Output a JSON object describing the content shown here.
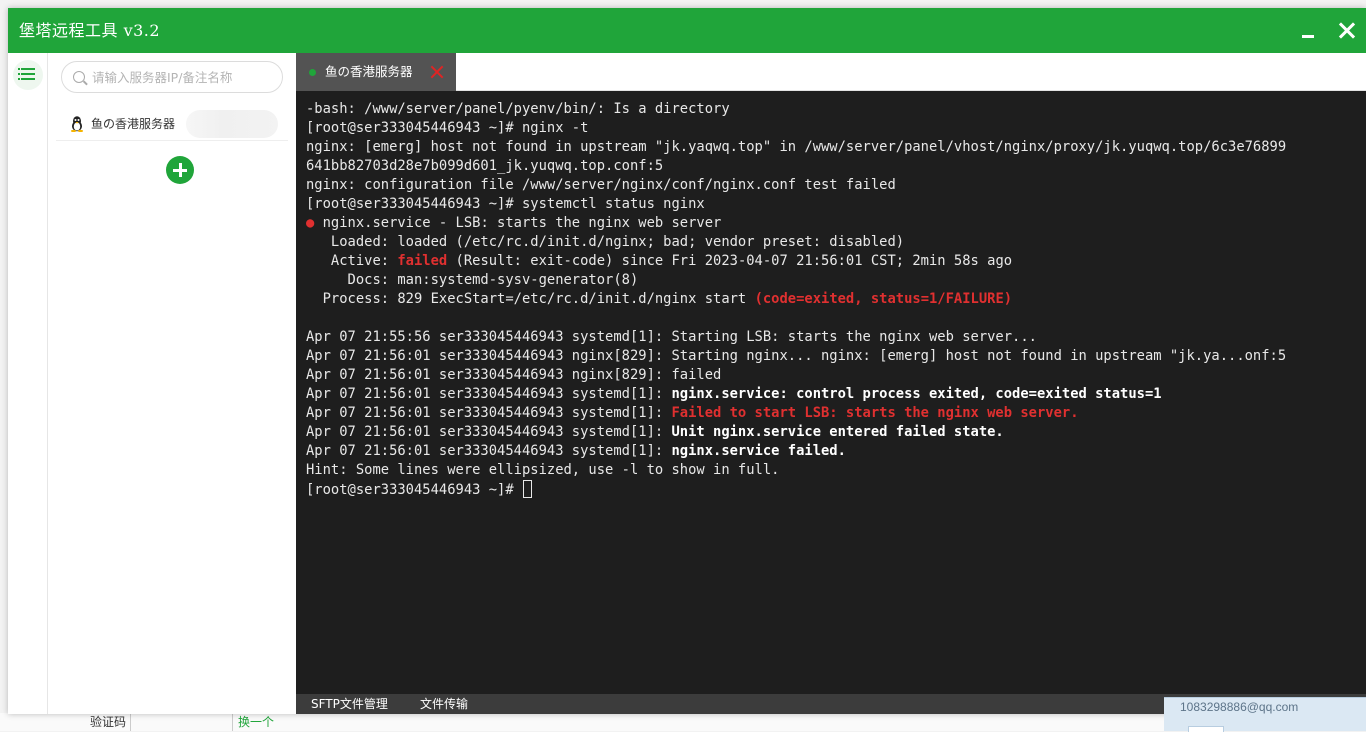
{
  "window": {
    "title": "堡塔远程工具 v3.2",
    "accent_color": "#20a53a"
  },
  "sidebar": {
    "search_placeholder": "请输入服务器IP/备注名称",
    "servers": [
      {
        "label": "鱼の香港服务器",
        "os_icon": "linux-tux-icon"
      }
    ]
  },
  "tabs": [
    {
      "label": "鱼の香港服务器",
      "status": "connected"
    }
  ],
  "terminal": {
    "lines": [
      [
        {
          "t": "-bash: /www/server/panel/pyenv/bin/: Is a directory"
        }
      ],
      [
        {
          "t": "[root@ser333045446943 ~]# nginx -t"
        }
      ],
      [
        {
          "t": "nginx: [emerg] host not found in upstream \"jk.yaqwq.top\" in /www/server/panel/vhost/nginx/proxy/jk.yuqwq.top/6c3e76899"
        }
      ],
      [
        {
          "t": "641bb82703d28e7b099d601_jk.yuqwq.top.conf:5"
        }
      ],
      [
        {
          "t": "nginx: configuration file /www/server/nginx/conf/nginx.conf test failed"
        }
      ],
      [
        {
          "t": "[root@ser333045446943 ~]# systemctl status nginx"
        }
      ],
      [
        {
          "t": "●",
          "s": "r"
        },
        {
          "t": " nginx.service - LSB: starts the nginx web server"
        }
      ],
      [
        {
          "t": "   Loaded: loaded (/etc/rc.d/init.d/nginx; bad; vendor preset: disabled)"
        }
      ],
      [
        {
          "t": "   Active: "
        },
        {
          "t": "failed",
          "s": "rb"
        },
        {
          "t": " (Result: exit-code) since Fri 2023-04-07 21:56:01 CST; 2min 58s ago"
        }
      ],
      [
        {
          "t": "     Docs: man:systemd-sysv-generator(8)"
        }
      ],
      [
        {
          "t": "  Process: 829 ExecStart=/etc/rc.d/init.d/nginx start "
        },
        {
          "t": "(code=exited, status=1/FAILURE)",
          "s": "rb"
        }
      ],
      [
        {
          "t": ""
        }
      ],
      [
        {
          "t": "Apr 07 21:55:56 ser333045446943 systemd[1]: Starting LSB: starts the nginx web server..."
        }
      ],
      [
        {
          "t": "Apr 07 21:56:01 ser333045446943 nginx[829]: Starting nginx... nginx: [emerg] host not found in upstream \"jk.ya...onf:5"
        }
      ],
      [
        {
          "t": "Apr 07 21:56:01 ser333045446943 nginx[829]: failed"
        }
      ],
      [
        {
          "t": "Apr 07 21:56:01 ser333045446943 systemd[1]: "
        },
        {
          "t": "nginx.service: control process exited, code=exited status=1",
          "s": "b"
        }
      ],
      [
        {
          "t": "Apr 07 21:56:01 ser333045446943 systemd[1]: "
        },
        {
          "t": "Failed to start LSB: starts the nginx web server.",
          "s": "rb"
        }
      ],
      [
        {
          "t": "Apr 07 21:56:01 ser333045446943 systemd[1]: "
        },
        {
          "t": "Unit nginx.service entered failed state.",
          "s": "b"
        }
      ],
      [
        {
          "t": "Apr 07 21:56:01 ser333045446943 systemd[1]: "
        },
        {
          "t": "nginx.service failed.",
          "s": "b"
        }
      ],
      [
        {
          "t": "Hint: Some lines were ellipsized, use -l to show in full."
        }
      ],
      [
        {
          "t": "[root@ser333045446943 ~]# "
        }
      ]
    ],
    "error_color": "#e03030",
    "background": "#1e1e1e"
  },
  "bottom_tabs": [
    {
      "label": "SFTP文件管理"
    },
    {
      "label": "文件传输"
    }
  ],
  "underlay": {
    "captcha_label": "验证码",
    "swap_link": "换一个"
  },
  "toast": {
    "text": "1083298886@qq.com"
  }
}
